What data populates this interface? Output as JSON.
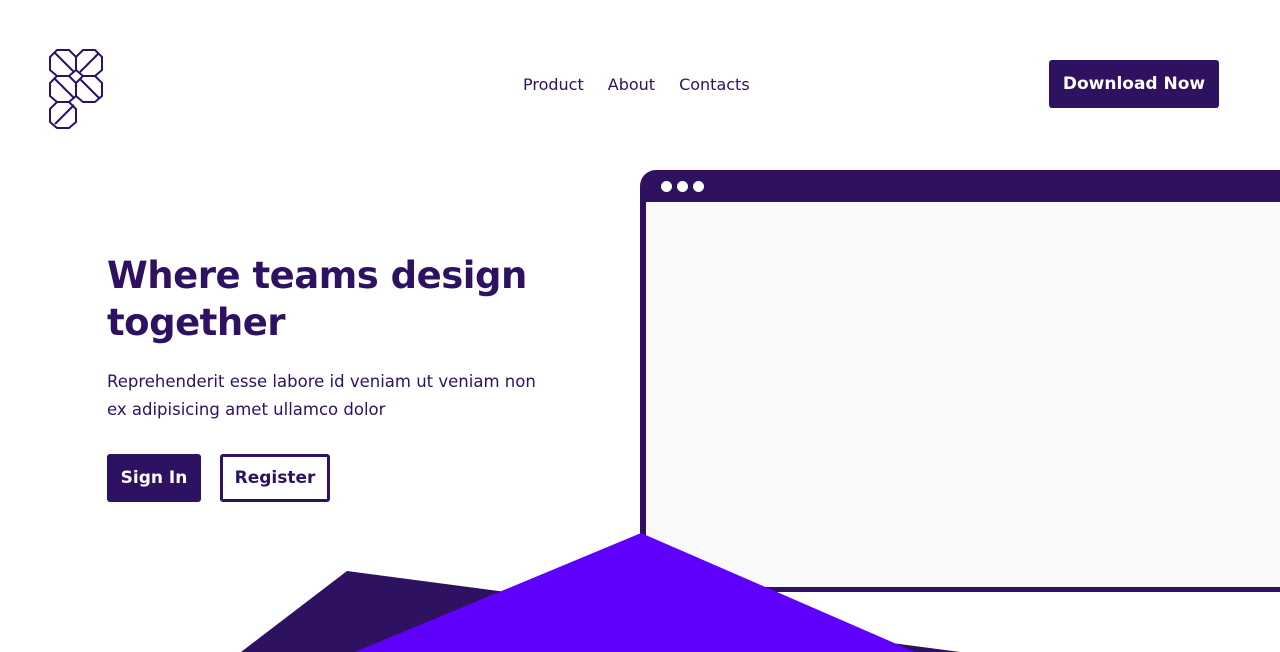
{
  "logo": {
    "icon": "figma-style-logo-icon"
  },
  "nav": {
    "items": [
      {
        "label": "Product"
      },
      {
        "label": "About"
      },
      {
        "label": "Contacts"
      }
    ]
  },
  "header": {
    "cta_label": "Download Now"
  },
  "hero": {
    "title": "Where teams design together",
    "description": "Reprehenderit esse labore id veniam ut veniam non ex adipisicing amet ullamco dolor",
    "signin_label": "Sign In",
    "register_label": "Register"
  },
  "browser_mockup": {
    "dots_icon": "window-dots-icon"
  },
  "colors": {
    "primary": "#2e1160",
    "accent": "#5f00ff",
    "background": "#ffffff",
    "viewport": "#f9f9fb"
  }
}
